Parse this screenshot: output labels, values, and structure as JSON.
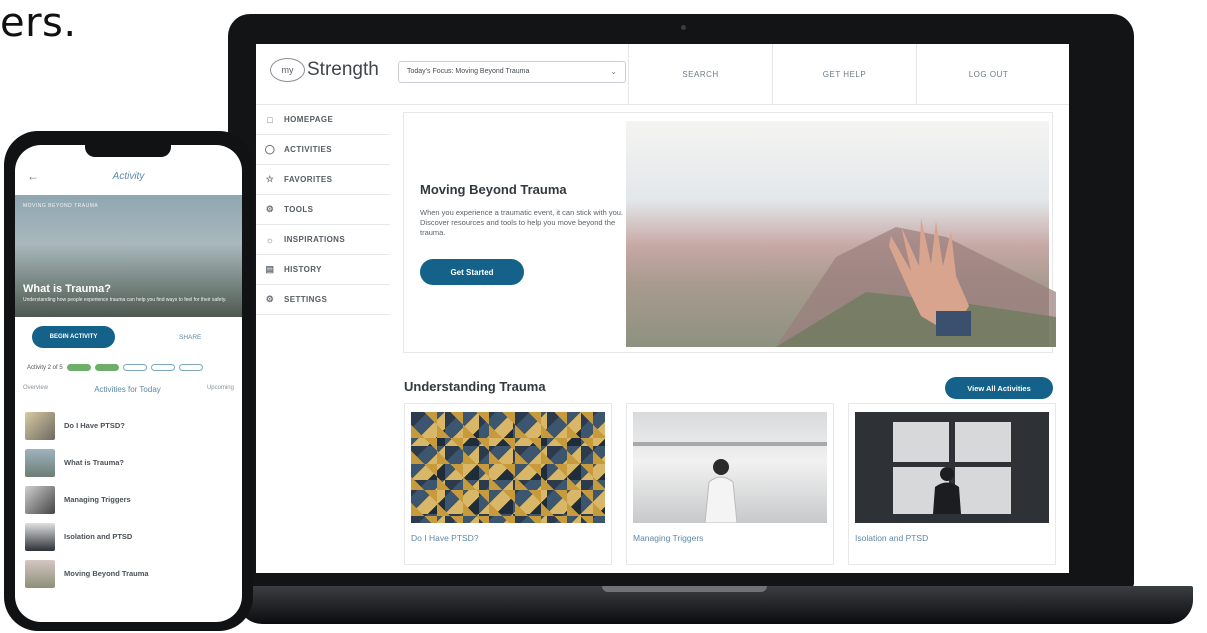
{
  "partial_heading": "ers.",
  "desktop": {
    "logo": {
      "badge": "my",
      "text": "Strength"
    },
    "focus_select": "Today's Focus: Moving Beyond Trauma",
    "topnav": [
      "SEARCH",
      "GET HELP",
      "LOG OUT"
    ],
    "sidebar": [
      {
        "label": "HOMEPAGE",
        "icon": "home-icon"
      },
      {
        "label": "ACTIVITIES",
        "icon": "activities-icon"
      },
      {
        "label": "FAVORITES",
        "icon": "star-icon"
      },
      {
        "label": "TOOLS",
        "icon": "tools-icon"
      },
      {
        "label": "INSPIRATIONS",
        "icon": "inspirations-icon"
      },
      {
        "label": "HISTORY",
        "icon": "history-icon"
      },
      {
        "label": "SETTINGS",
        "icon": "settings-icon"
      }
    ],
    "hero": {
      "title": "Moving Beyond Trauma",
      "description": "When you experience a traumatic event, it can stick with you. Discover resources and tools to help you move beyond the trauma.",
      "button": "Get Started"
    },
    "section": {
      "title": "Understanding Trauma",
      "view_all": "View All Activities",
      "cards": [
        {
          "title": "Do I Have PTSD?"
        },
        {
          "title": "Managing Triggers"
        },
        {
          "title": "Isolation and PTSD"
        }
      ]
    }
  },
  "phone": {
    "header_title": "Activity",
    "hero_top": "MOVING BEYOND TRAUMA",
    "hero_title": "What is Trauma?",
    "hero_sub": "Understanding how people experience trauma can help you find ways to feel for their safety.",
    "begin_button": "BEGIN ACTIVITY",
    "share_label": "SHARE",
    "progress_label": "Activity 2 of 5",
    "tabs": {
      "left": "Overview",
      "center": "Activities for Today",
      "right": "Upcoming"
    },
    "list": [
      "Do I Have PTSD?",
      "What is Trauma?",
      "Managing Triggers",
      "Isolation and PTSD",
      "Moving Beyond Trauma"
    ]
  },
  "colors": {
    "accent": "#14628a",
    "link": "#5e88a6",
    "progress": "#6cae6a"
  }
}
